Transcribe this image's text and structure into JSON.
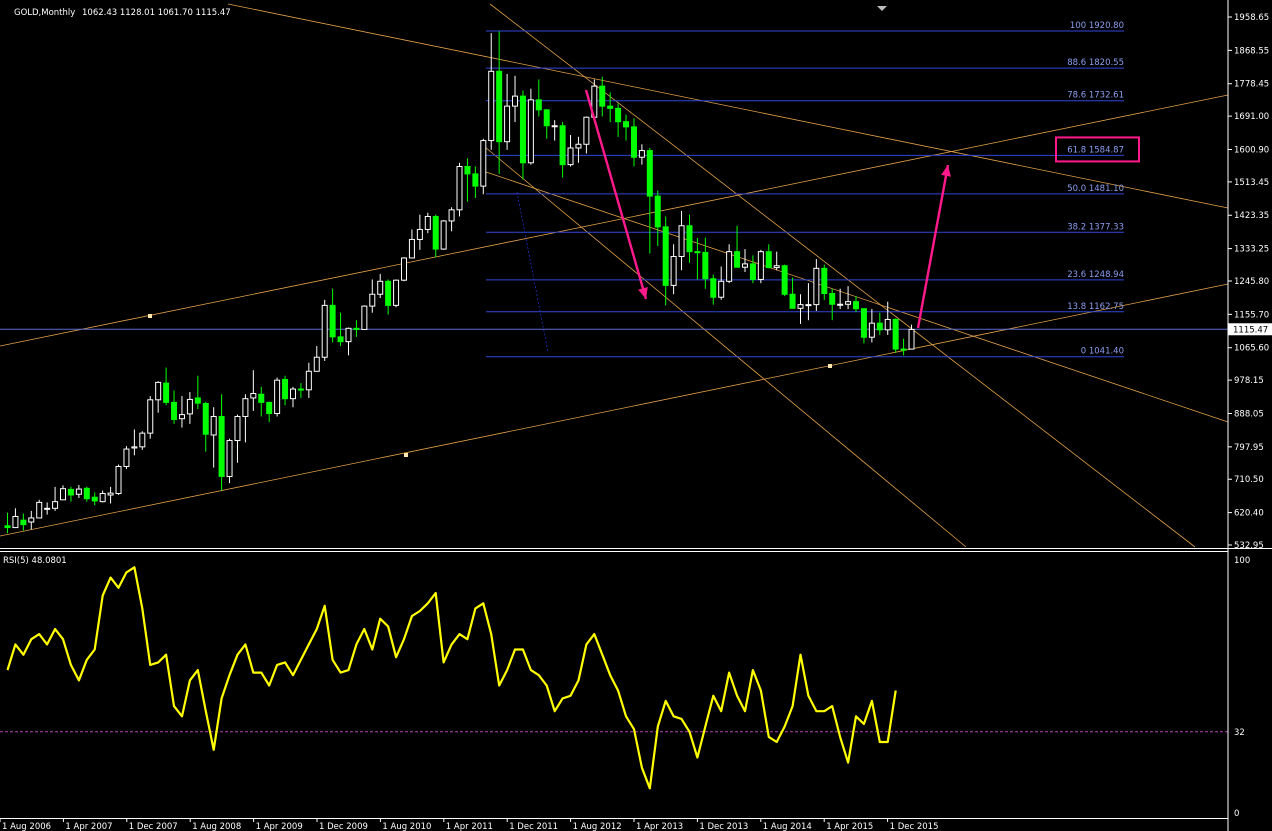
{
  "header": {
    "symbol": "GOLD,Monthly",
    "ohlc": "1062.43 1128.01 1061.70 1115.47"
  },
  "price_axis": {
    "ticks": [
      "1958.65",
      "1868.55",
      "1778.45",
      "1691.00",
      "1600.90",
      "1513.45",
      "1423.35",
      "1333.25",
      "1245.80",
      "1155.70",
      "1065.60",
      "978.15",
      "888.05",
      "797.95",
      "710.50",
      "620.40",
      "532.95"
    ],
    "current_price": "1115.47"
  },
  "time_axis": {
    "labels": [
      "1 Aug 2006",
      "1 Apr 2007",
      "1 Dec 2007",
      "1 Aug 2008",
      "1 Apr 2009",
      "1 Dec 2009",
      "1 Aug 2010",
      "1 Apr 2011",
      "1 Dec 2011",
      "1 Aug 2012",
      "1 Apr 2013",
      "1 Dec 2013",
      "1 Aug 2014",
      "1 Apr 2015",
      "1 Dec 2015"
    ]
  },
  "fib_levels": [
    {
      "label": "100 1920.80",
      "price": 1920.8
    },
    {
      "label": "88.6 1820.55",
      "price": 1820.55
    },
    {
      "label": "78.6 1732.61",
      "price": 1732.61
    },
    {
      "label": "61.8 1584.87",
      "price": 1584.87,
      "highlight": true
    },
    {
      "label": "50.0 1481.10",
      "price": 1481.1
    },
    {
      "label": "38.2 1377.33",
      "price": 1377.33
    },
    {
      "label": "23.6 1248.94",
      "price": 1248.94
    },
    {
      "label": "13.8 1162.75",
      "price": 1162.75
    },
    {
      "label": "0 1041.40",
      "price": 1041.4
    }
  ],
  "rsi": {
    "title": "RSI(5) 48.0801",
    "ticks": [
      "100",
      "32",
      "0"
    ],
    "level": 32
  },
  "colors": {
    "background": "#000000",
    "bull_candle": "#ffffff",
    "bear_candle": "#00ff00",
    "fib": "#3046d8",
    "fib_text": "#8c9ff0",
    "trendline": "#e0a048",
    "arrow": "#ff1a8c",
    "rsi_line": "#ffff00",
    "rsi_level": "#b040b0",
    "grid_text": "#ffffff"
  },
  "chart_data": {
    "type": "candlestick",
    "title": "GOLD,Monthly",
    "ylim": [
      532.95,
      1985
    ],
    "x_range": [
      "2006-07-01",
      "2016-01-01"
    ],
    "current_price": 1115.47,
    "candles": [
      [
        "2006-07-01",
        585,
        620,
        565,
        580
      ],
      [
        "2006-08-01",
        580,
        632,
        585,
        610
      ],
      [
        "2006-09-01",
        600,
        618,
        572,
        588
      ],
      [
        "2006-10-01",
        595,
        625,
        575,
        606
      ],
      [
        "2006-11-01",
        606,
        655,
        616,
        648
      ],
      [
        "2006-12-01",
        632,
        648,
        615,
        632
      ],
      [
        "2007-01-01",
        632,
        690,
        625,
        650
      ],
      [
        "2007-02-01",
        655,
        694,
        658,
        685
      ],
      [
        "2007-03-01",
        683,
        690,
        650,
        668
      ],
      [
        "2007-04-01",
        670,
        695,
        660,
        684
      ],
      [
        "2007-05-01",
        686,
        690,
        650,
        658
      ],
      [
        "2007-06-01",
        662,
        675,
        640,
        652
      ],
      [
        "2007-07-01",
        650,
        680,
        648,
        672
      ],
      [
        "2007-08-01",
        668,
        690,
        645,
        673
      ],
      [
        "2007-09-01",
        672,
        750,
        668,
        745
      ],
      [
        "2007-10-01",
        745,
        800,
        738,
        792
      ],
      [
        "2007-11-01",
        795,
        845,
        775,
        798
      ],
      [
        "2007-12-01",
        798,
        840,
        790,
        835
      ],
      [
        "2008-01-01",
        835,
        935,
        820,
        925
      ],
      [
        "2008-02-01",
        925,
        975,
        890,
        972
      ],
      [
        "2008-03-01",
        970,
        1012,
        910,
        918
      ],
      [
        "2008-04-01",
        918,
        950,
        860,
        872
      ],
      [
        "2008-05-01",
        874,
        935,
        850,
        885
      ],
      [
        "2008-06-01",
        887,
        946,
        860,
        926
      ],
      [
        "2008-07-01",
        930,
        990,
        900,
        916
      ],
      [
        "2008-08-01",
        915,
        920,
        785,
        832
      ],
      [
        "2008-09-01",
        830,
        905,
        742,
        880
      ],
      [
        "2008-10-01",
        880,
        940,
        680,
        718
      ],
      [
        "2008-11-01",
        718,
        820,
        700,
        815
      ],
      [
        "2008-12-01",
        815,
        885,
        755,
        880
      ],
      [
        "2009-01-01",
        880,
        940,
        810,
        928
      ],
      [
        "2009-02-01",
        930,
        1005,
        895,
        942
      ],
      [
        "2009-03-01",
        940,
        960,
        880,
        918
      ],
      [
        "2009-04-01",
        918,
        920,
        865,
        888
      ],
      [
        "2009-05-01",
        888,
        985,
        880,
        978
      ],
      [
        "2009-06-01",
        980,
        990,
        910,
        928
      ],
      [
        "2009-07-01",
        928,
        960,
        905,
        954
      ],
      [
        "2009-08-01",
        954,
        970,
        930,
        952
      ],
      [
        "2009-09-01",
        952,
        1025,
        930,
        1002
      ],
      [
        "2009-10-01",
        1002,
        1070,
        1005,
        1040
      ],
      [
        "2009-11-01",
        1040,
        1195,
        1030,
        1180
      ],
      [
        "2009-12-01",
        1180,
        1225,
        1080,
        1095
      ],
      [
        "2010-01-01",
        1095,
        1160,
        1070,
        1082
      ],
      [
        "2010-02-01",
        1082,
        1120,
        1045,
        1118
      ],
      [
        "2010-03-01",
        1118,
        1140,
        1095,
        1115
      ],
      [
        "2010-04-01",
        1115,
        1180,
        1115,
        1178
      ],
      [
        "2010-05-01",
        1178,
        1250,
        1160,
        1210
      ],
      [
        "2010-06-01",
        1210,
        1265,
        1200,
        1245
      ],
      [
        "2010-07-01",
        1245,
        1250,
        1155,
        1180
      ],
      [
        "2010-08-01",
        1180,
        1250,
        1175,
        1248
      ],
      [
        "2010-09-01",
        1248,
        1310,
        1245,
        1308
      ],
      [
        "2010-10-01",
        1308,
        1385,
        1315,
        1358
      ],
      [
        "2010-11-01",
        1358,
        1425,
        1330,
        1385
      ],
      [
        "2010-12-01",
        1385,
        1430,
        1375,
        1420
      ],
      [
        "2011-01-01",
        1420,
        1425,
        1310,
        1332
      ],
      [
        "2011-02-01",
        1332,
        1410,
        1330,
        1408
      ],
      [
        "2011-03-01",
        1408,
        1445,
        1380,
        1438
      ],
      [
        "2011-04-01",
        1438,
        1565,
        1420,
        1555
      ],
      [
        "2011-05-01",
        1555,
        1577,
        1460,
        1535
      ],
      [
        "2011-06-01",
        1535,
        1555,
        1470,
        1502
      ],
      [
        "2011-07-01",
        1502,
        1630,
        1480,
        1625
      ],
      [
        "2011-08-01",
        1625,
        1915,
        1600,
        1812
      ],
      [
        "2011-09-01",
        1812,
        1920,
        1535,
        1622
      ],
      [
        "2011-10-01",
        1622,
        1805,
        1600,
        1718
      ],
      [
        "2011-11-01",
        1718,
        1800,
        1675,
        1745
      ],
      [
        "2011-12-01",
        1745,
        1760,
        1520,
        1565
      ],
      [
        "2012-01-01",
        1565,
        1765,
        1560,
        1735
      ],
      [
        "2012-02-01",
        1735,
        1790,
        1690,
        1708
      ],
      [
        "2012-03-01",
        1708,
        1710,
        1630,
        1665
      ],
      [
        "2012-04-01",
        1665,
        1680,
        1625,
        1665
      ],
      [
        "2012-05-01",
        1665,
        1675,
        1525,
        1560
      ],
      [
        "2012-06-01",
        1560,
        1640,
        1555,
        1605
      ],
      [
        "2012-07-01",
        1605,
        1635,
        1565,
        1615
      ],
      [
        "2012-08-01",
        1615,
        1690,
        1590,
        1688
      ],
      [
        "2012-09-01",
        1688,
        1790,
        1680,
        1772
      ],
      [
        "2012-10-01",
        1772,
        1797,
        1690,
        1718
      ],
      [
        "2012-11-01",
        1718,
        1755,
        1675,
        1712
      ],
      [
        "2012-12-01",
        1712,
        1725,
        1635,
        1676
      ],
      [
        "2013-01-01",
        1676,
        1695,
        1625,
        1662
      ],
      [
        "2013-02-01",
        1662,
        1685,
        1555,
        1580
      ],
      [
        "2013-03-01",
        1580,
        1615,
        1560,
        1598
      ],
      [
        "2013-04-01",
        1598,
        1605,
        1320,
        1475
      ],
      [
        "2013-05-01",
        1475,
        1490,
        1340,
        1392
      ],
      [
        "2013-06-01",
        1392,
        1420,
        1180,
        1234
      ],
      [
        "2013-07-01",
        1234,
        1345,
        1210,
        1312
      ],
      [
        "2013-08-01",
        1312,
        1435,
        1275,
        1395
      ],
      [
        "2013-09-01",
        1395,
        1425,
        1295,
        1325
      ],
      [
        "2013-10-01",
        1325,
        1362,
        1250,
        1323
      ],
      [
        "2013-11-01",
        1323,
        1363,
        1225,
        1252
      ],
      [
        "2013-12-01",
        1252,
        1263,
        1182,
        1202
      ],
      [
        "2014-01-01",
        1202,
        1285,
        1195,
        1245
      ],
      [
        "2014-02-01",
        1245,
        1345,
        1240,
        1325
      ],
      [
        "2014-03-01",
        1325,
        1395,
        1285,
        1283
      ],
      [
        "2014-04-01",
        1283,
        1332,
        1270,
        1292
      ],
      [
        "2014-05-01",
        1292,
        1315,
        1240,
        1250
      ],
      [
        "2014-06-01",
        1250,
        1330,
        1240,
        1325
      ],
      [
        "2014-07-01",
        1325,
        1345,
        1280,
        1282
      ],
      [
        "2014-08-01",
        1282,
        1325,
        1275,
        1287
      ],
      [
        "2014-09-01",
        1287,
        1290,
        1205,
        1210
      ],
      [
        "2014-10-01",
        1210,
        1255,
        1180,
        1172
      ],
      [
        "2014-11-01",
        1172,
        1210,
        1130,
        1182
      ],
      [
        "2014-12-01",
        1182,
        1240,
        1140,
        1182
      ],
      [
        "2015-01-01",
        1182,
        1305,
        1165,
        1280
      ],
      [
        "2015-02-01",
        1280,
        1290,
        1195,
        1212
      ],
      [
        "2015-03-01",
        1212,
        1225,
        1140,
        1183
      ],
      [
        "2015-04-01",
        1183,
        1225,
        1170,
        1183
      ],
      [
        "2015-05-01",
        1183,
        1232,
        1170,
        1190
      ],
      [
        "2015-06-01",
        1190,
        1205,
        1162,
        1171
      ],
      [
        "2015-07-01",
        1171,
        1172,
        1077,
        1094
      ],
      [
        "2015-08-01",
        1094,
        1170,
        1080,
        1132
      ],
      [
        "2015-09-01",
        1132,
        1160,
        1100,
        1114
      ],
      [
        "2015-10-01",
        1114,
        1190,
        1100,
        1142
      ],
      [
        "2015-11-01",
        1142,
        1145,
        1052,
        1062
      ],
      [
        "2015-12-01",
        1062,
        1090,
        1045,
        1061
      ],
      [
        "2016-01-01",
        1062,
        1128,
        1062,
        1115
      ]
    ],
    "rsi": [
      56,
      66,
      62,
      68,
      70,
      66,
      72,
      68,
      58,
      52,
      60,
      64,
      85,
      92,
      88,
      94,
      96,
      80,
      58,
      59,
      62,
      42,
      38,
      52,
      56,
      40,
      25,
      45,
      54,
      62,
      66,
      55,
      55,
      50,
      58,
      59,
      54,
      60,
      66,
      72,
      81,
      60,
      55,
      56,
      66,
      72,
      64,
      76,
      73,
      61,
      68,
      77,
      79,
      82,
      86,
      59,
      66,
      70,
      68,
      80,
      82,
      70,
      50,
      56,
      64,
      64,
      56,
      54,
      50,
      40,
      45,
      46,
      52,
      66,
      70,
      62,
      54,
      48,
      38,
      33,
      18,
      10,
      34,
      44,
      38,
      37,
      32,
      22,
      34,
      46,
      40,
      55,
      46,
      40,
      56,
      48,
      30,
      28,
      34,
      42,
      62,
      46,
      40,
      40,
      42,
      30,
      20,
      38,
      35,
      44,
      28,
      28,
      48
    ],
    "rsi_series_name": "RSI(5) 48.0801",
    "rsi_level": 32,
    "fib_high": 1920.8,
    "fib_low": 1041.4
  }
}
